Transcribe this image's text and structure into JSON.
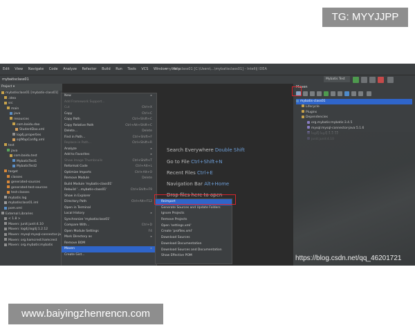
{
  "watermarks": {
    "top": "TG: MYYJJPP",
    "bottom": "www.baiyingzhenrencn.com",
    "csdn": "https://blog.csdn.net/qq_46201721"
  },
  "menubar": {
    "items": [
      "Edit",
      "View",
      "Navigate",
      "Code",
      "Analyze",
      "Refactor",
      "Build",
      "Run",
      "Tools",
      "VCS",
      "Window",
      "Help"
    ],
    "title": "mybatisclass01 [C:\\Users\\...\\mybatisclass01] - IntelliJ IDEA",
    "run_config": "Mybatis Test"
  },
  "nav": {
    "path": "mybatisclass01"
  },
  "project_panel": {
    "header": "Project ▾",
    "tree": [
      "mybatisclass01 [mybatis-class01]",
      ".idea",
      "src",
      "main",
      "java",
      "resources",
      "com.baidu.dao",
      "StudentDao.xml",
      "log4j.properties",
      "sqlMapConfig.xml",
      "test",
      "java",
      "com.baidu.test",
      "MybatisTest1",
      "MybatisTest2",
      "target",
      "classes",
      "generated-sources",
      "generated-test-sources",
      "test-classes",
      "mybatis.log",
      "mybatisclass01.iml",
      "pom.xml",
      "External Libraries",
      "< 1.8 >",
      "Maven: junit:junit:4.10",
      "Maven: log4j:log4j:1.2.12",
      "Maven: mysql:mysql-connector-java",
      "Maven: org.hamcrest:hamcrest",
      "Maven: org.mybatis:mybatis"
    ]
  },
  "context_menu": {
    "items": [
      {
        "label": "New",
        "shortcut": "▸",
        "disabled": false
      },
      {
        "label": "Add Framework Support...",
        "shortcut": "",
        "disabled": true
      },
      {
        "label": "Cut",
        "shortcut": "Ctrl+X",
        "disabled": true
      },
      {
        "label": "Copy",
        "shortcut": "Ctrl+C",
        "disabled": false
      },
      {
        "label": "Copy Path",
        "shortcut": "Ctrl+Shift+C",
        "disabled": false
      },
      {
        "label": "Copy Relative Path",
        "shortcut": "Ctrl+Alt+Shift+C",
        "disabled": false
      },
      {
        "label": "Delete...",
        "shortcut": "Delete",
        "disabled": false
      },
      {
        "label": "Find in Path...",
        "shortcut": "Ctrl+Shift+F",
        "disabled": false
      },
      {
        "label": "Replace in Path...",
        "shortcut": "Ctrl+Shift+R",
        "disabled": true
      },
      {
        "label": "Analyze",
        "shortcut": "▸",
        "disabled": false
      },
      {
        "label": "Add to Favorites",
        "shortcut": "▸",
        "disabled": false
      },
      {
        "label": "Show Image Thumbnails",
        "shortcut": "Ctrl+Shift+T",
        "disabled": true
      },
      {
        "label": "Reformat Code",
        "shortcut": "Ctrl+Alt+L",
        "disabled": false
      },
      {
        "label": "Optimize Imports",
        "shortcut": "Ctrl+Alt+O",
        "disabled": false
      },
      {
        "label": "Remove Module",
        "shortcut": "Delete",
        "disabled": false
      },
      {
        "label": "Build Module 'mybatis-class01'",
        "shortcut": "",
        "disabled": false
      },
      {
        "label": "Rebuild '...mybatis-class01'",
        "shortcut": "Ctrl+Shift+F9",
        "disabled": false
      },
      {
        "label": "Show in Explorer",
        "shortcut": "",
        "disabled": false
      },
      {
        "label": "Directory Path",
        "shortcut": "Ctrl+Alt+F12",
        "disabled": false
      },
      {
        "label": "Open in Terminal",
        "shortcut": "",
        "disabled": false
      },
      {
        "label": "Local History",
        "shortcut": "▸",
        "disabled": false
      },
      {
        "label": "Synchronize 'mybatisclass01'",
        "shortcut": "",
        "disabled": false
      },
      {
        "label": "Compare With...",
        "shortcut": "Ctrl+D",
        "disabled": false
      },
      {
        "label": "Open Module Settings",
        "shortcut": "F4",
        "disabled": false
      },
      {
        "label": "Mark Directory as",
        "shortcut": "▸",
        "disabled": false
      },
      {
        "label": "Remove BOM",
        "shortcut": "",
        "disabled": false
      },
      {
        "label": "Maven",
        "shortcut": "▸",
        "disabled": false,
        "selected": true
      },
      {
        "label": "Create Gist...",
        "shortcut": "",
        "disabled": false
      }
    ]
  },
  "editor_hints": [
    {
      "text": "Search Everywhere",
      "key": "Double Shift"
    },
    {
      "text": "Go to File",
      "key": "Ctrl+Shift+N"
    },
    {
      "text": "Recent Files",
      "key": "Ctrl+E"
    },
    {
      "text": "Navigation Bar",
      "key": "Alt+Home"
    },
    {
      "text": "Drop files here to open",
      "key": ""
    }
  ],
  "maven_submenu": {
    "items": [
      {
        "label": "Reimport",
        "selected": true
      },
      {
        "label": "Generate Sources and Update Folders",
        "selected": false
      },
      {
        "label": "Ignore Projects",
        "selected": false
      },
      {
        "label": "Remove Projects",
        "selected": false
      },
      {
        "label": "Open 'settings.xml'",
        "selected": false
      },
      {
        "label": "Create 'profiles.xml'",
        "selected": false
      },
      {
        "label": "Download Sources",
        "selected": false
      },
      {
        "label": "Download Documentation",
        "selected": false
      },
      {
        "label": "Download Sources and Documentation",
        "selected": false
      },
      {
        "label": "Show Effective POM",
        "selected": false
      }
    ]
  },
  "maven_panel": {
    "header": "Maven",
    "tree": [
      {
        "label": "mybatis-class01",
        "selected": true
      },
      {
        "label": "Lifecycle",
        "selected": false
      },
      {
        "label": "Plugins",
        "selected": false
      },
      {
        "label": "Dependencies",
        "selected": false
      },
      {
        "label": "org.mybatis:mybatis:3.4.5",
        "selected": false
      },
      {
        "label": "mysql:mysql-connector-java:5.1.6",
        "selected": false
      },
      {
        "label": "log4j:log4j:1.2.12",
        "selected": false
      },
      {
        "label": "junit:junit:4.10",
        "selected": false
      }
    ]
  },
  "colors": {
    "highlight_box": "#d8262d",
    "selection": "#2f65ca",
    "ide_background": "#2b2b2b",
    "panel_background": "#3c3f41"
  }
}
